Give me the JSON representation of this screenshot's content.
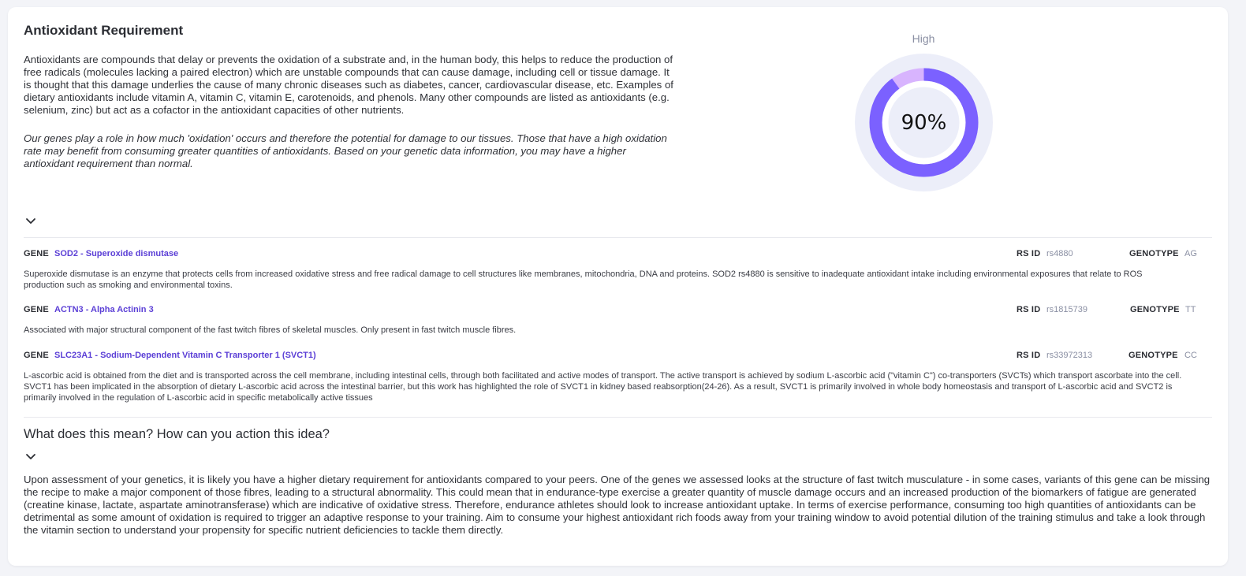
{
  "title": "Antioxidant Requirement",
  "intro": "Antioxidants are compounds that delay or prevents the oxidation of a substrate and, in the human body, this helps to reduce the production of free radicals (molecules lacking a paired electron) which are unstable compounds that can cause damage, including cell or tissue damage. It is thought that this damage underlies the cause of many chronic diseases such as diabetes, cancer, cardiovascular disease, etc. Examples of dietary antioxidants include vitamin A, vitamin C, vitamin E, carotenoids, and phenols. Many other compounds are listed as antioxidants (e.g. selenium, zinc) but act as a cofactor in the antioxidant capacities of other nutrients.",
  "intro_italic": "Our genes play a role in how much 'oxidation' occurs and therefore the potential for damage to our tissues. Those that have a high oxidation rate may benefit from consuming greater quantities of antioxidants. Based on your genetic data information, you may have a higher antioxidant requirement than normal.",
  "gauge": {
    "level_label": "High",
    "value_text": "90%",
    "value_fraction": 0.9,
    "colors": {
      "track_outer": "#eceef9",
      "fill": "#7b61ff",
      "remainder": "#d8b4fe"
    }
  },
  "gene_labels": {
    "gene": "GENE",
    "rsid": "RS ID",
    "genotype": "GENOTYPE"
  },
  "genes": [
    {
      "name": "SOD2 - Superoxide dismutase",
      "rsid": "rs4880",
      "genotype": "AG",
      "description": "Superoxide dismutase is an enzyme that protects cells from increased oxidative stress and free radical damage to cell structures like membranes, mitochondria, DNA and proteins. SOD2 rs4880 is sensitive to inadequate antioxidant intake including environmental exposures that relate to ROS production such as smoking and environmental toxins."
    },
    {
      "name": "ACTN3 - Alpha Actinin 3",
      "rsid": "rs1815739",
      "genotype": "TT",
      "description": "Associated with major structural component of the fast twitch fibres of skeletal muscles. Only present in fast twitch muscle fibres."
    },
    {
      "name": "SLC23A1 - Sodium-Dependent Vitamin C Transporter 1 (SVCT1)",
      "rsid": "rs33972313",
      "genotype": "CC",
      "description": "L-ascorbic acid is obtained from the diet and is transported across the cell membrane, including intestinal cells, through both facilitated and active modes of transport. The active transport is achieved by sodium L-ascorbic acid (\"vitamin C\") co-transporters (SVCTs) which transport ascorbate into the cell. SVCT1 has been implicated in the absorption of dietary L-ascorbic acid across the intestinal barrier, but this work has highlighted the role of SVCT1 in kidney based reabsorption(24-26). As a result, SVCT1 is primarily involved in whole body homeostasis and transport of L-ascorbic acid and SVCT2 is primarily involved in the regulation of L-ascorbic acid in specific metabolically active tissues"
    }
  ],
  "action": {
    "title": "What does this mean? How can you action this idea?",
    "text": "Upon assessment of your genetics, it is likely you have a higher dietary requirement for antioxidants compared to your peers. One of the genes we assessed looks at the structure of fast twitch musculature - in some cases, variants of this gene can be missing the recipe to make a major component of those fibres, leading to a structural abnormality. This could mean that in endurance-type exercise a greater quantity of muscle damage occurs and an increased production of the biomarkers of fatigue are generated (creatine kinase, lactate, aspartate aminotransferase) which are indicative of oxidative stress. Therefore, endurance athletes should look to increase antioxidant uptake. In terms of exercise performance, consuming too high quantities of antioxidants can be detrimental as some amount of oxidation is required to trigger an adaptive response to your training. Aim to consume your highest antioxidant rich foods away from your training window to avoid potential dilution of the training stimulus and take a look through the vitamin section to understand your propensity for specific nutrient deficiencies to tackle them directly."
  },
  "icons": {
    "expand": "chevron-down-icon"
  }
}
